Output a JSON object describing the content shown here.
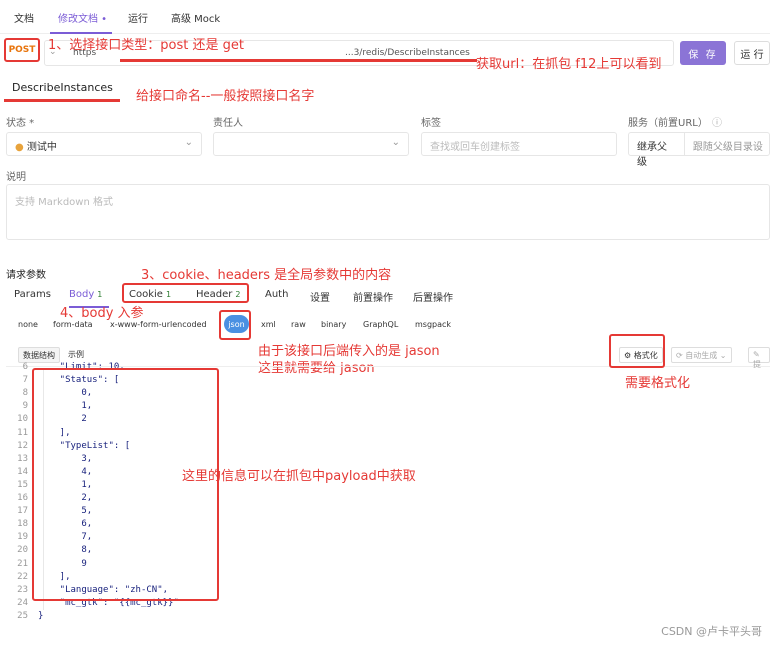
{
  "tabs": [
    {
      "label": "文档"
    },
    {
      "label": "修改文档 •"
    },
    {
      "label": "运行"
    },
    {
      "label": "高级 Mock"
    }
  ],
  "request": {
    "method": "POST",
    "url_prefix": "https",
    "url_suffix": "...3/redis/DescribeInstances",
    "save_label": "保 存",
    "run_label": "运 行"
  },
  "annotations": {
    "a1": "1、选择接口类型：post 还是 get",
    "a2": "获取url：在抓包 f12上可以看到",
    "a3": "给接口命名--一般按照接口名字",
    "a4": "3、cookie、headers 是全局参数中的内容",
    "a5": "4、body 入参",
    "a6": "由于该接口后端传入的是 jason",
    "a7": "这里就需要给 jason",
    "a8": "需要格式化",
    "a9": "这里的信息可以在抓包中payload中获取"
  },
  "interface_name": "DescribeInstances",
  "fields": {
    "status_label": "状态 *",
    "status_value": "测试中",
    "owner_label": "责任人",
    "tags_label": "标签",
    "tags_placeholder": "查找或回车创建标签",
    "service_label": "服务（前置URL）",
    "service_value": "继承父级",
    "service_hint": "跟随父级目录设",
    "desc_label": "说明",
    "desc_placeholder": "支持 Markdown 格式"
  },
  "params": {
    "title": "请求参数",
    "tabs": [
      "Params",
      "Body",
      "Cookie",
      "Header",
      "Auth",
      "设置",
      "前置操作",
      "后置操作"
    ],
    "body_count": "1",
    "cookie_count": "1",
    "header_count": "2",
    "body_types": [
      "none",
      "form-data",
      "x-www-form-urlencoded",
      "json",
      "xml",
      "raw",
      "binary",
      "GraphQL",
      "msgpack"
    ]
  },
  "editor": {
    "schema_label": "数据结构",
    "example_label": "示例",
    "format_label": "格式化",
    "autogen_label": "自动生成",
    "extra_label": "提"
  },
  "code_lines": [
    {
      "n": "6",
      "t": "    \"Limit\": 10,"
    },
    {
      "n": "7",
      "t": "    \"Status\": ["
    },
    {
      "n": "8",
      "t": "        0,"
    },
    {
      "n": "9",
      "t": "        1,"
    },
    {
      "n": "10",
      "t": "        2"
    },
    {
      "n": "11",
      "t": "    ],"
    },
    {
      "n": "12",
      "t": "    \"TypeList\": ["
    },
    {
      "n": "13",
      "t": "        3,"
    },
    {
      "n": "14",
      "t": "        4,"
    },
    {
      "n": "15",
      "t": "        1,"
    },
    {
      "n": "16",
      "t": "        2,"
    },
    {
      "n": "17",
      "t": "        5,"
    },
    {
      "n": "18",
      "t": "        6,"
    },
    {
      "n": "19",
      "t": "        7,"
    },
    {
      "n": "20",
      "t": "        8,"
    },
    {
      "n": "21",
      "t": "        9"
    },
    {
      "n": "22",
      "t": "    ],"
    },
    {
      "n": "23",
      "t": "    \"Language\": \"zh-CN\","
    },
    {
      "n": "24",
      "t": "    \"mc_gtk\": \"{{mc_gtk}}\""
    },
    {
      "n": "25",
      "t": "}"
    }
  ],
  "watermark": "CSDN @卢卡平头哥",
  "colors": {
    "accent": "#7b5cd6",
    "annotation": "#e53935",
    "method": "#e8740c",
    "json_pill": "#4a90e2"
  }
}
